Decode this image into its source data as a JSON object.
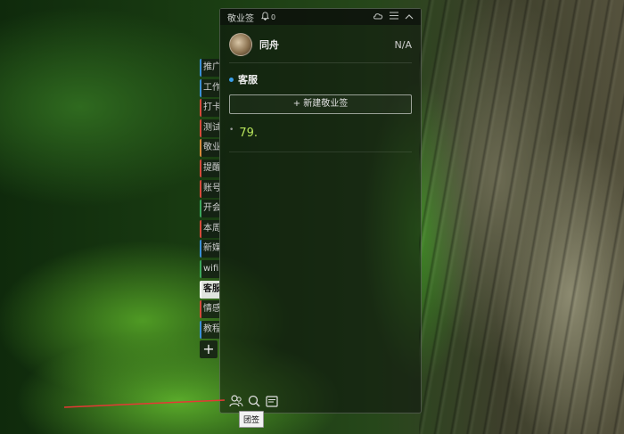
{
  "app": {
    "title": "敬业签",
    "notification_count": "0"
  },
  "titlebar_icons": [
    "cloud-icon",
    "menu-icon",
    "collapse-icon"
  ],
  "user": {
    "name": "同舟",
    "status": "N/A"
  },
  "side_tabs": [
    {
      "label": "推广",
      "color": "blue"
    },
    {
      "label": "工作",
      "color": "blue"
    },
    {
      "label": "打卡",
      "color": "red"
    },
    {
      "label": "测试",
      "color": "red"
    },
    {
      "label": "敬业",
      "color": "orange"
    },
    {
      "label": "提醒",
      "color": "red"
    },
    {
      "label": "账号",
      "color": "red"
    },
    {
      "label": "开会",
      "color": "green"
    },
    {
      "label": "本周",
      "color": "red"
    },
    {
      "label": "新媒",
      "color": "blue"
    },
    {
      "label": "wifi",
      "color": "green"
    },
    {
      "label": "客服",
      "color": "active"
    },
    {
      "label": "情感",
      "color": "red"
    },
    {
      "label": "教程",
      "color": "blue"
    }
  ],
  "side_add_label": "+",
  "section": {
    "title": "客服",
    "new_button": "+ 新建敬业签"
  },
  "notes": [
    {
      "text": "79."
    }
  ],
  "bottom_bar": [
    "team-icon",
    "search-icon",
    "notes-icon"
  ],
  "tooltip": "团签",
  "colors": {
    "accent": "#3a9ee8",
    "note_text": "#b6e35a",
    "pointer": "#e53935"
  }
}
